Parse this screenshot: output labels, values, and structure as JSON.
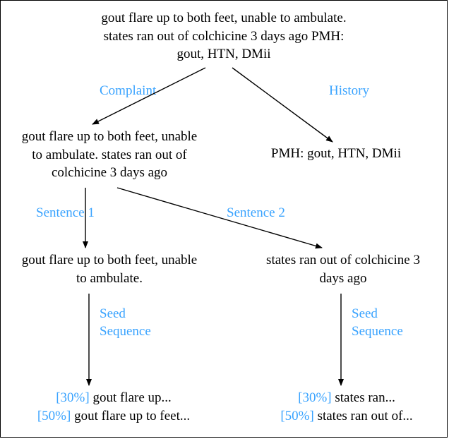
{
  "root": {
    "line1": "gout flare up to both feet, unable to ambulate.",
    "line2": "states ran out of colchicine 3 days ago PMH:",
    "line3": "gout, HTN, DMii"
  },
  "edges": {
    "complaint": "Complaint",
    "history": "History",
    "sentence1": "Sentence 1",
    "sentence2": "Sentence 2",
    "seed1_l1": "Seed",
    "seed1_l2": "Sequence",
    "seed2_l1": "Seed",
    "seed2_l2": "Sequence"
  },
  "complaint_node": {
    "line1": "gout flare up to both feet, unable",
    "line2": "to ambulate. states ran out of",
    "line3": "colchicine 3 days ago"
  },
  "history_node": "PMH: gout, HTN, DMii",
  "s1_node": {
    "line1": "gout flare up to both feet, unable",
    "line2": "to ambulate."
  },
  "s2_node": {
    "line1": "states ran out of colchicine 3",
    "line2": "days ago"
  },
  "seed1": {
    "p1": "[30%] ",
    "t1": "gout flare up...",
    "p2": "[50%] ",
    "t2": "gout flare up to feet..."
  },
  "seed2": {
    "p1": "[30%] ",
    "t1": "states ran...",
    "p2": "[50%] ",
    "t2": "states ran out of..."
  },
  "chart_data": {
    "type": "diagram",
    "description": "Hierarchical text decomposition tree",
    "nodes": [
      {
        "id": "root",
        "text": "gout flare up to both feet, unable to ambulate. states ran out of colchicine 3 days ago PMH: gout, HTN, DMii"
      },
      {
        "id": "complaint",
        "text": "gout flare up to both feet, unable to ambulate. states ran out of colchicine 3 days ago"
      },
      {
        "id": "history",
        "text": "PMH: gout, HTN, DMii"
      },
      {
        "id": "s1",
        "text": "gout flare up to both feet, unable to ambulate."
      },
      {
        "id": "s2",
        "text": "states ran out of colchicine 3 days ago"
      },
      {
        "id": "seed1_30",
        "text": "[30%] gout flare up..."
      },
      {
        "id": "seed1_50",
        "text": "[50%] gout flare up to feet..."
      },
      {
        "id": "seed2_30",
        "text": "[30%] states ran..."
      },
      {
        "id": "seed2_50",
        "text": "[50%] states ran out of..."
      }
    ],
    "edges": [
      {
        "from": "root",
        "to": "complaint",
        "label": "Complaint"
      },
      {
        "from": "root",
        "to": "history",
        "label": "History"
      },
      {
        "from": "complaint",
        "to": "s1",
        "label": "Sentence 1"
      },
      {
        "from": "complaint",
        "to": "s2",
        "label": "Sentence 2"
      },
      {
        "from": "s1",
        "to": "seed1_30",
        "label": "Seed Sequence"
      },
      {
        "from": "s1",
        "to": "seed1_50",
        "label": "Seed Sequence"
      },
      {
        "from": "s2",
        "to": "seed2_30",
        "label": "Seed Sequence"
      },
      {
        "from": "s2",
        "to": "seed2_50",
        "label": "Seed Sequence"
      }
    ]
  }
}
